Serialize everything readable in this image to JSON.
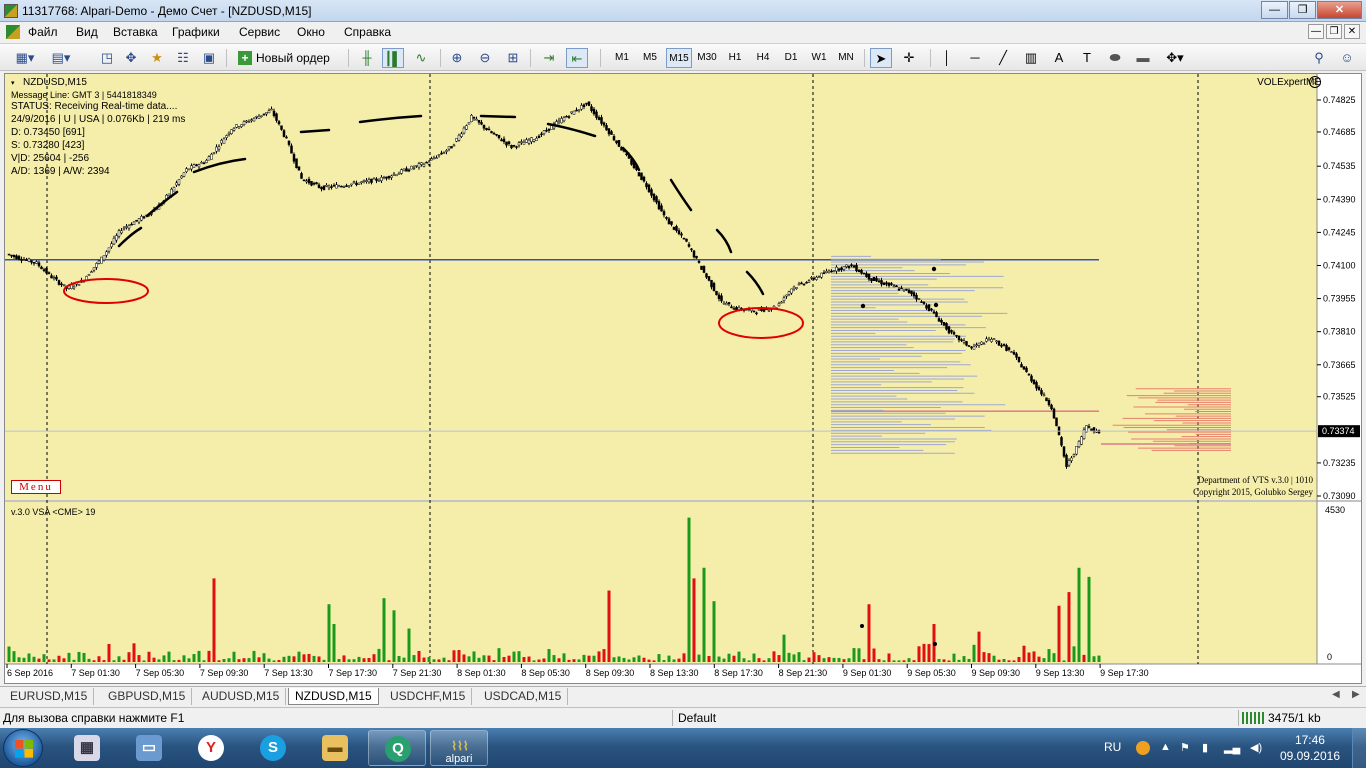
{
  "window": {
    "title": "11317768: Alpari-Demo - Демо Счет - [NZDUSD,M15]",
    "min_label": "—",
    "max_label": "❐",
    "close_label": "✕"
  },
  "menu": [
    "Файл",
    "Вид",
    "Вставка",
    "Графики",
    "Сервис",
    "Окно",
    "Справка"
  ],
  "mdi_controls": [
    "—",
    "❐",
    "✕"
  ],
  "toolbar": {
    "new_order_label": "Новый ордер",
    "timeframes": [
      "M1",
      "M5",
      "M15",
      "M30",
      "H1",
      "H4",
      "D1",
      "W1",
      "MN"
    ],
    "active_timeframe": "M15",
    "icons": [
      "new-chart-icon",
      "profiles-icon",
      "crosshair-move-icon",
      "favorites-icon",
      "navigator-icon",
      "new-order-icon",
      "bar-chart-icon",
      "candle-chart-icon",
      "line-chart-icon",
      "zoom-in-icon",
      "zoom-out-icon",
      "tile-icon",
      "autoscroll-icon",
      "chart-shift-icon",
      "cursor-icon",
      "crosshair-icon",
      "vline-icon",
      "hline-icon",
      "trendline-icon",
      "channel-icon",
      "text-icon",
      "text-label-icon",
      "ellipse-icon",
      "rectangle-icon",
      "arrows-icon",
      "search-icon",
      "account-icon"
    ]
  },
  "chart": {
    "symbol_label": "NZDUSD,M15",
    "info_lines": [
      "Message Line: GMT 3 | 5441818349",
      "STATUS:  Receiving Real-time data....",
      "24/9/2016 | U | USA | 0.076Kb | 219 ms",
      "D: 0.73450  [691]",
      "S: 0.73280  [423]",
      "V|D: 25604 | -256",
      "A/D: 1369 | A/W: 2394"
    ],
    "expert_name": "VOLExpertME",
    "menu_button": "Menu",
    "vts_line1": "Department of VTS  v.3.0 | 1010",
    "vts_line2": "Copyright 2015, Golubko Sergey",
    "current_price": "0.73374",
    "price_ticks": [
      "0.74825",
      "0.74685",
      "0.74535",
      "0.74390",
      "0.74245",
      "0.74100",
      "0.73955",
      "0.73810",
      "0.73665",
      "0.73525",
      "0.73235",
      "0.73090"
    ],
    "time_ticks": [
      "6 Sep 2016",
      "7 Sep 01:30",
      "7 Sep 05:30",
      "7 Sep 09:30",
      "7 Sep 13:30",
      "7 Sep 17:30",
      "7 Sep 21:30",
      "8 Sep 01:30",
      "8 Sep 05:30",
      "8 Sep 09:30",
      "8 Sep 13:30",
      "8 Sep 17:30",
      "8 Sep 21:30",
      "9 Sep 01:30",
      "9 Sep 05:30",
      "9 Sep 09:30",
      "9 Sep 13:30",
      "9 Sep 17:30"
    ],
    "volume_label": "v.3.0 VSA <CME> 19",
    "volume_max": "4530",
    "volume_min": "0",
    "colors": {
      "background": "#f5eeaa",
      "candle": "#000000",
      "support_line": "#3050c0",
      "highlight_circle": "#e00000",
      "volume_up": "#1a9a1a",
      "volume_down": "#e01010",
      "profile": "#a0a8d0",
      "profile_right": "#e8806a"
    }
  },
  "tabs": [
    "EURUSD,M15",
    "GBPUSD,M15",
    "AUDUSD,M15",
    "NZDUSD,M15",
    "USDCHF,M15",
    "USDCAD,M15"
  ],
  "active_tab": "NZDUSD,M15",
  "status": {
    "help": "Для вызова справки нажмите F1",
    "profile": "Default",
    "connection": "3475/1 kb"
  },
  "taskbar": {
    "apps": [
      "explorer-icon",
      "calculator-icon",
      "computer-icon",
      "yandex-icon",
      "skype-icon",
      "folder-icon",
      "qip-icon",
      "alpari-icon"
    ],
    "alpari_label": "alpari",
    "language": "RU",
    "time": "17:46",
    "date": "09.09.2016"
  }
}
